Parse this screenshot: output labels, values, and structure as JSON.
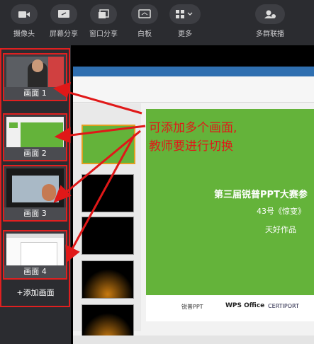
{
  "toolbar": {
    "camera": "摄像头",
    "screen_share": "屏幕分享",
    "window_share": "窗口分享",
    "whiteboard": "白板",
    "more": "更多",
    "multi_group": "多群联播"
  },
  "scenes": [
    {
      "label": "画面 1"
    },
    {
      "label": "画面 2"
    },
    {
      "label": "画面 3"
    },
    {
      "label": "画面 4"
    }
  ],
  "add_scene": "+添加画面",
  "callout": {
    "line1": "可添加多个画面,",
    "line2": "教师要进行切换"
  },
  "slide": {
    "title": "第三届锐普PPT大赛参",
    "subtitle": "43号《惊变》",
    "author": "天好作品",
    "logos": [
      "锐普PPT",
      "WPS Office",
      "CERTIPORT"
    ]
  },
  "colors": {
    "accent": "#e02020",
    "slide_green": "#64b33a"
  }
}
